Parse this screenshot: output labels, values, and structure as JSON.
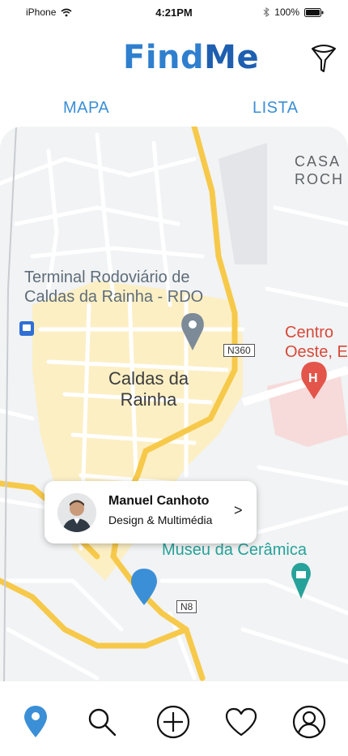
{
  "status_bar": {
    "carrier": "iPhone",
    "time": "4:21PM",
    "battery": "100%"
  },
  "header": {
    "logo_find": "Find",
    "logo_me": "Me",
    "filter_icon": "filter-icon"
  },
  "tabs": [
    {
      "label": "MAPA"
    },
    {
      "label": "LISTA"
    }
  ],
  "map": {
    "labels": {
      "terminal_line1": "Terminal Rodoviário de",
      "terminal_line2": "Caldas da Rainha - RDO",
      "city_line1": "Caldas da",
      "city_line2": "Rainha",
      "casal_line1": "CASA",
      "casal_line2": "ROCH",
      "centro_line1": "Centro",
      "centro_line2": "Oeste, E",
      "museu": "Museu da Cerâmica",
      "road_n360": "N360",
      "road_n8": "N8"
    }
  },
  "profile_card": {
    "name": "Manuel Canhoto",
    "role": "Design & Multimédia",
    "chevron": ">"
  },
  "bottom_nav": [
    {
      "icon": "map-pin-icon",
      "active": true
    },
    {
      "icon": "search-icon",
      "active": false
    },
    {
      "icon": "add-icon",
      "active": false
    },
    {
      "icon": "heart-icon",
      "active": false
    },
    {
      "icon": "profile-icon",
      "active": false
    }
  ],
  "colors": {
    "accent": "#3b8fd6",
    "logo": "#2f7fcf",
    "road_major": "#f7c94a",
    "city_area": "#fcefc4"
  }
}
